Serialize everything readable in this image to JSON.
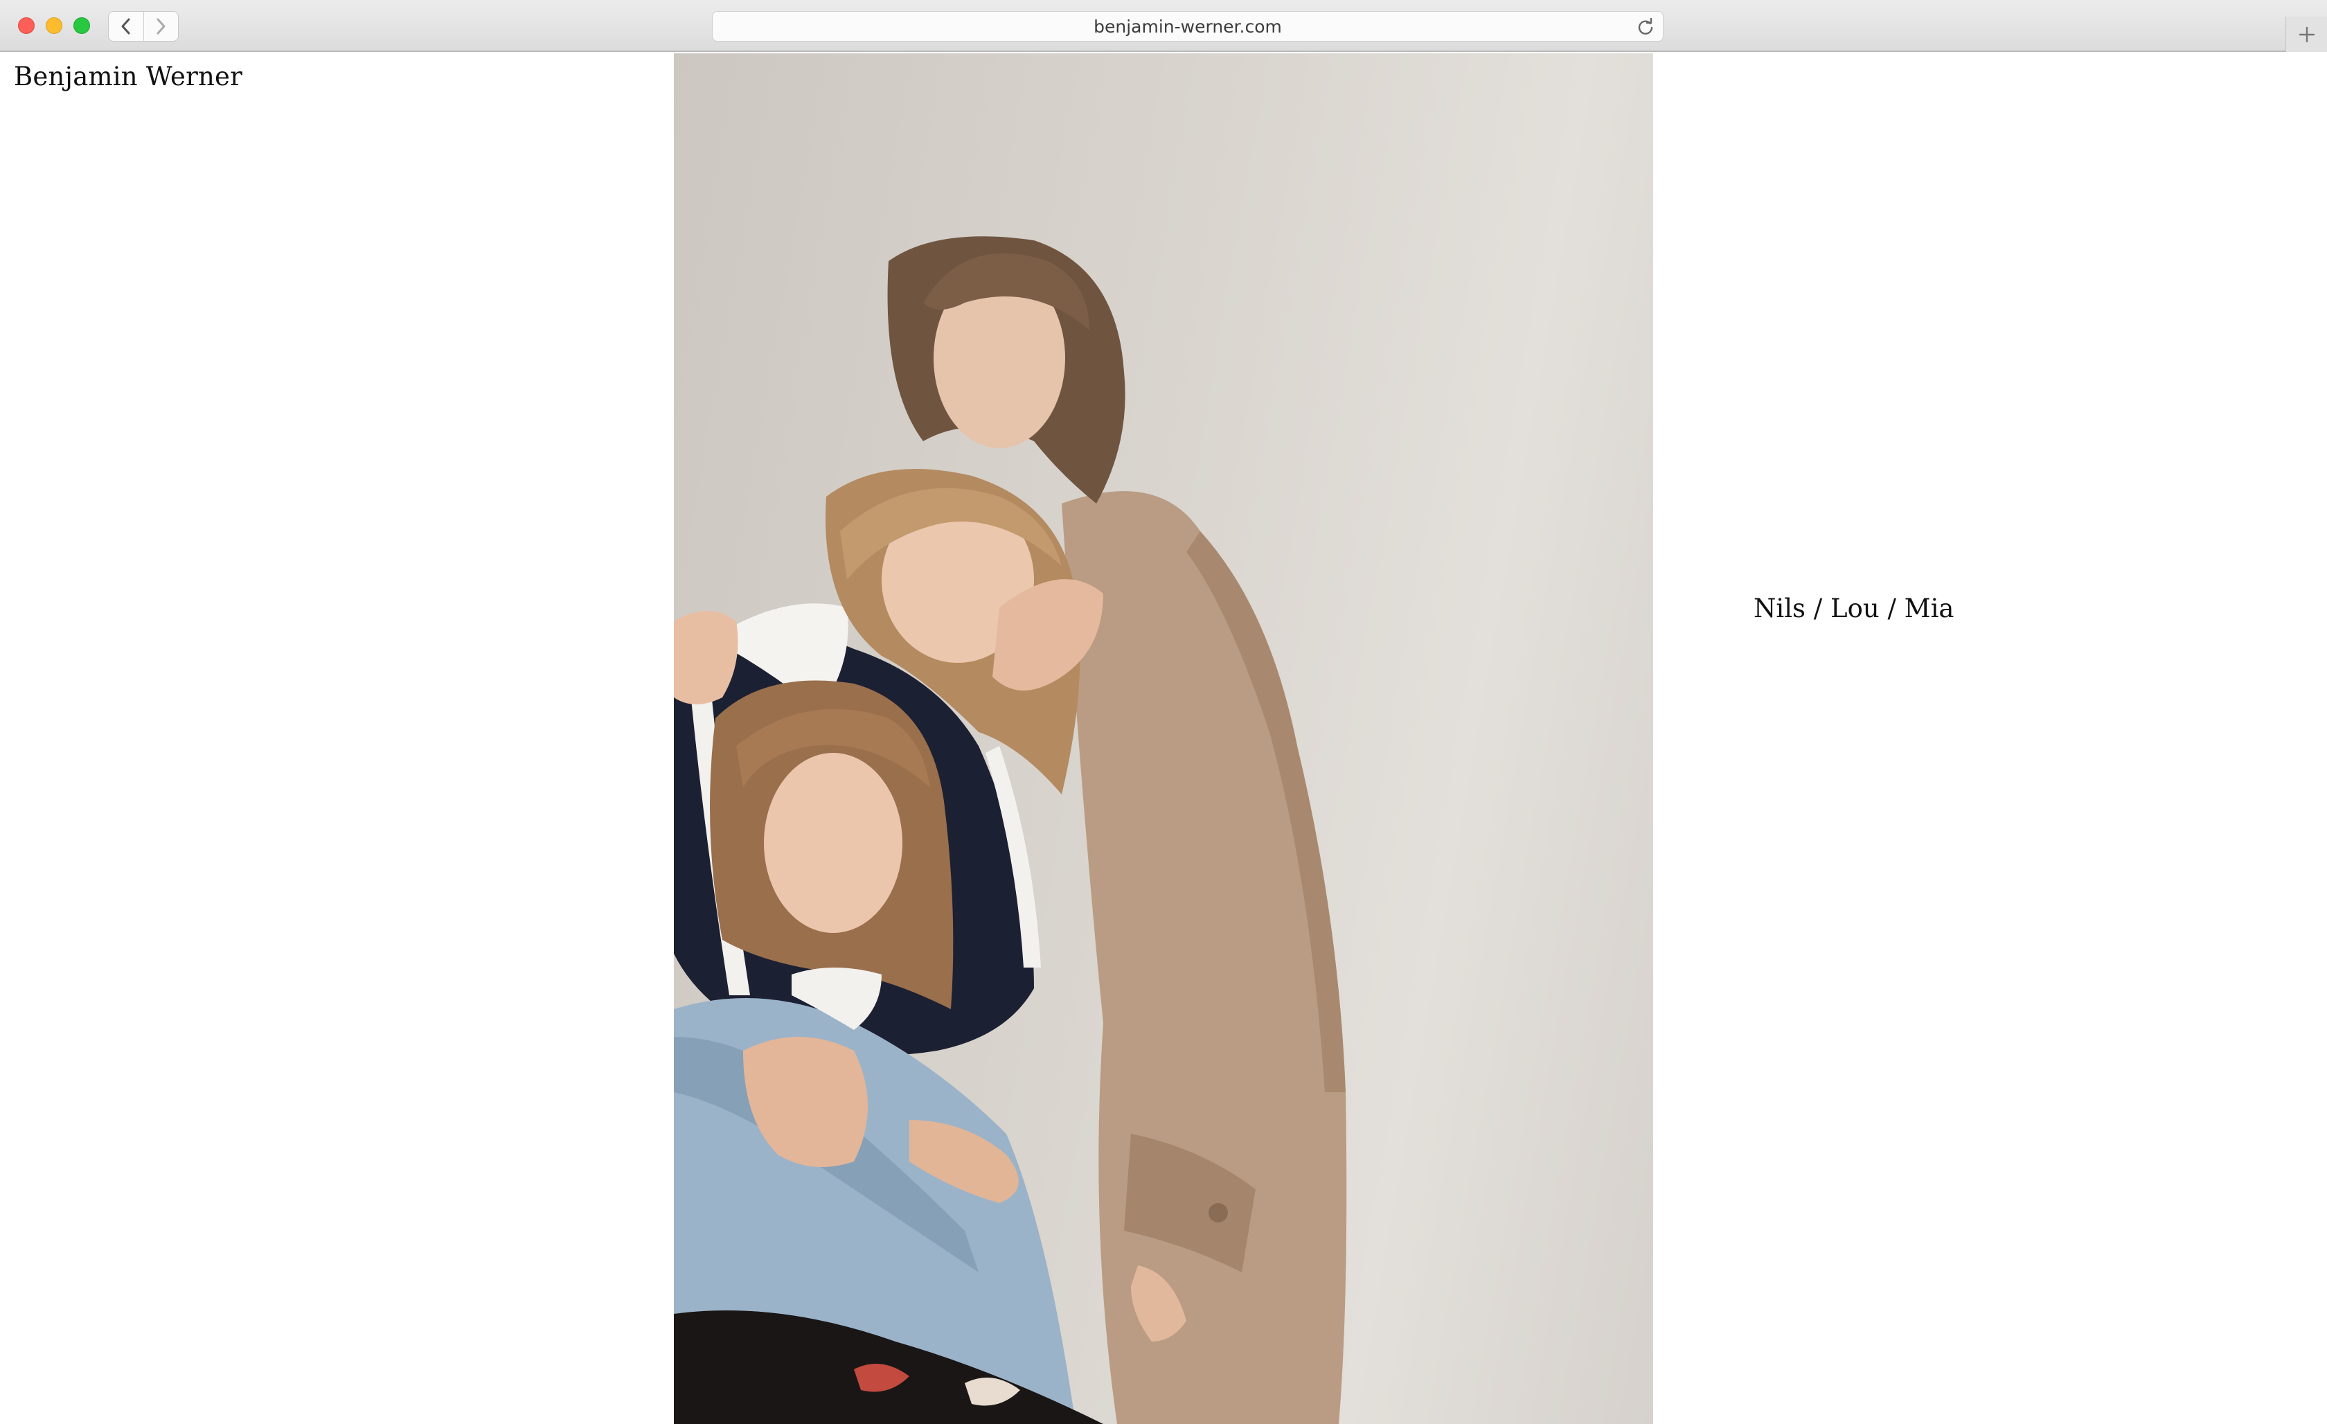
{
  "browser": {
    "url": "benjamin-werner.com"
  },
  "site": {
    "title": "Benjamin Werner"
  },
  "photo": {
    "caption": "Nils / Lou / Mia"
  },
  "icons": {
    "back": "chevron-left-icon",
    "forward": "chevron-right-icon",
    "reload": "reload-icon",
    "new_tab": "plus-icon"
  },
  "colors": {
    "close": "#fc5f57",
    "minimize": "#fdbc2e",
    "maximize": "#28c840",
    "text": "#111111",
    "background": "#ffffff"
  }
}
